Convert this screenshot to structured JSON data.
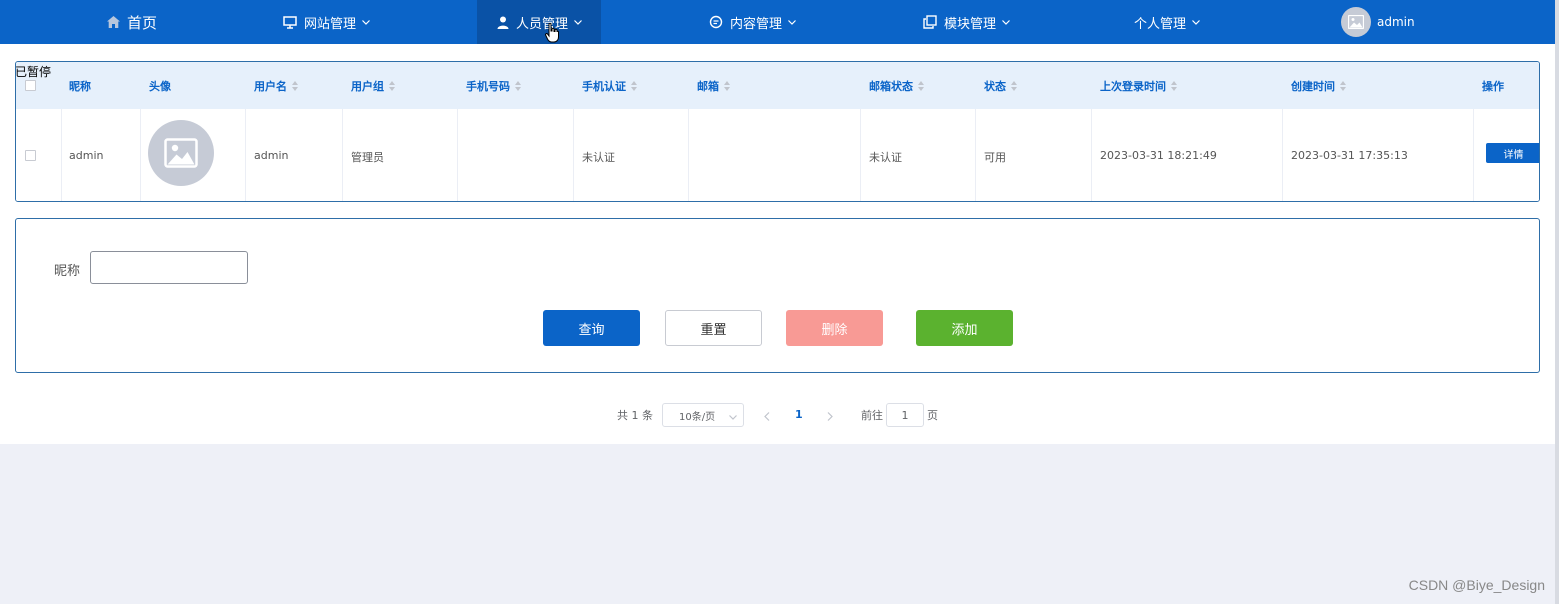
{
  "nav": {
    "items": [
      {
        "label": "首页",
        "icon": "home-icon"
      },
      {
        "label": "网站管理",
        "icon": "monitor-icon"
      },
      {
        "label": "人员管理",
        "icon": "user-icon"
      },
      {
        "label": "内容管理",
        "icon": "chat-icon"
      },
      {
        "label": "模块管理",
        "icon": "copy-icon"
      },
      {
        "label": "个人管理",
        "icon": ""
      }
    ],
    "active_index": 2,
    "user": {
      "name": "admin",
      "icon": "avatar-icon"
    },
    "colors": {
      "bar": "#0b64c8",
      "active": "#0a52a6"
    }
  },
  "overlay_text": "已暂停",
  "table": {
    "columns": [
      "昵称",
      "头像",
      "用户名",
      "用户组",
      "手机号码",
      "手机认证",
      "邮箱",
      "邮箱状态",
      "状态",
      "上次登录时间",
      "创建时间",
      "操作"
    ],
    "rows": [
      {
        "nickname": "admin",
        "avatar": "image-placeholder-icon",
        "username": "admin",
        "group": "管理员",
        "phone": "",
        "phone_verified": "未认证",
        "email": "",
        "email_status": "未认证",
        "status": "可用",
        "last_login": "2023-03-31 18:21:49",
        "created": "2023-03-31 17:35:13",
        "action": "详情"
      }
    ]
  },
  "search": {
    "label": "昵称",
    "value": "",
    "placeholder": "",
    "buttons": {
      "query": "查询",
      "reset": "重置",
      "delete": "删除",
      "add": "添加"
    },
    "colors": {
      "query": "#0b64c8",
      "delete": "#f89a95",
      "add": "#5bb22f"
    }
  },
  "pagination": {
    "total_text": "共 1 条",
    "page_size": "10条/页",
    "current_page": "1",
    "goto_prefix": "前往",
    "goto_value": "1",
    "goto_suffix": "页"
  },
  "watermark": "CSDN @Biye_Design"
}
